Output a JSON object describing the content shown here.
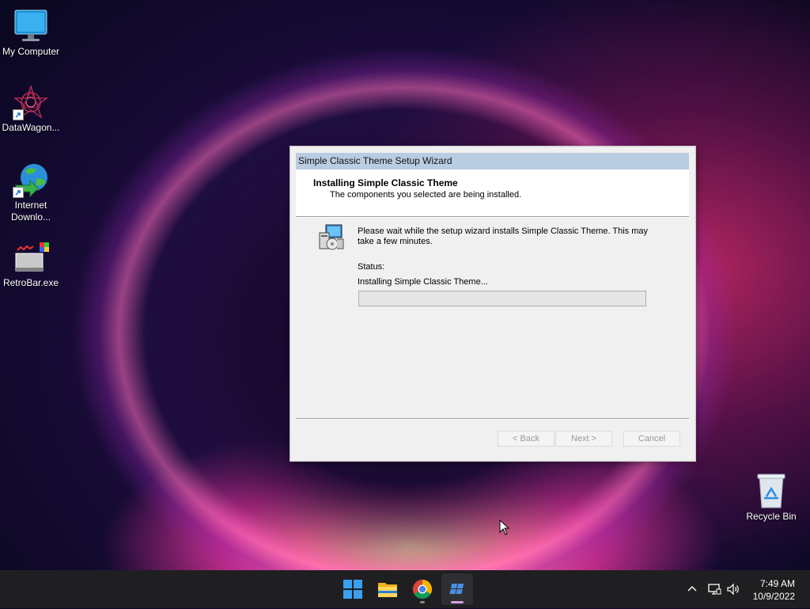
{
  "desktop": {
    "icons": [
      {
        "label": "My Computer",
        "icon": "monitor-icon"
      },
      {
        "label": "DataWagon...",
        "icon": "datawagon-icon"
      },
      {
        "label": "Internet\nDownlo...",
        "label_line1": "Internet",
        "label_line2": "Downlo...",
        "icon": "internet-download-manager-icon"
      },
      {
        "label": "RetroBar.exe",
        "icon": "retrobar-icon"
      },
      {
        "label": "Recycle Bin",
        "icon": "recycle-bin-icon"
      }
    ]
  },
  "dialog": {
    "title": "Simple Classic Theme Setup Wizard",
    "header_title": "Installing Simple Classic Theme",
    "header_subtitle": "The components you selected are being installed.",
    "body_text": "Please wait while the setup wizard installs Simple Classic Theme. This may take a few minutes.",
    "status_label": "Status:",
    "status_text": "Installing Simple Classic Theme...",
    "progress": 0,
    "buttons": {
      "back": "< Back",
      "next": "Next >",
      "cancel": "Cancel"
    },
    "icon": "installer-computer-icon"
  },
  "taskbar": {
    "apps": [
      {
        "name": "Start",
        "icon": "windows-start-icon"
      },
      {
        "name": "File Explorer",
        "icon": "file-explorer-icon"
      },
      {
        "name": "Google Chrome",
        "icon": "chrome-icon"
      },
      {
        "name": "Setup",
        "icon": "setup-wizard-icon",
        "active": true
      }
    ],
    "tray": {
      "chevron": "show-hidden-icons",
      "network": "network-icon",
      "volume": "volume-icon"
    },
    "clock": {
      "time": "7:49 AM",
      "date": "10/9/2022"
    }
  },
  "colors": {
    "titlebar": "#b8cde1",
    "taskbar": "#1f1f22",
    "accent": "#0078d4"
  }
}
